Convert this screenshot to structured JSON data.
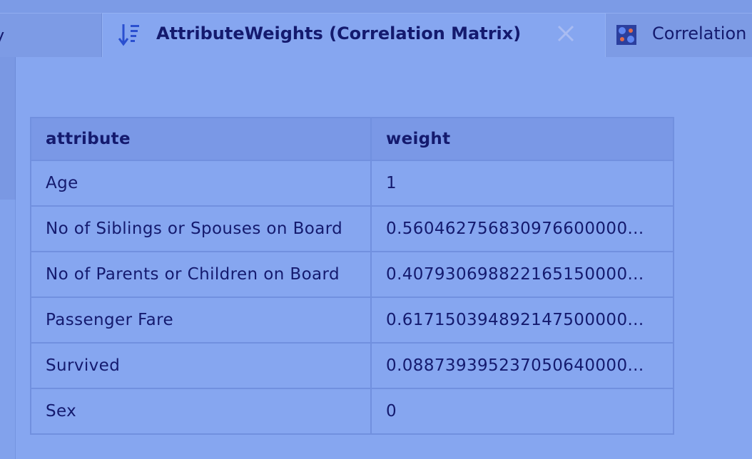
{
  "tabs": {
    "left": {
      "label": "y"
    },
    "active": {
      "label": "AttributeWeights (Correlation Matrix)",
      "icon": "sort-descending-icon"
    },
    "right": {
      "label": "Correlation",
      "icon": "correlation-matrix-icon"
    }
  },
  "table": {
    "headers": [
      "attribute",
      "weight"
    ],
    "rows": [
      [
        "Age",
        "1"
      ],
      [
        "No of Siblings or Spouses on Board",
        "0.560462756830976600000..."
      ],
      [
        "No of Parents or Children on Board",
        "0.407930698822165150000..."
      ],
      [
        "Passenger Fare",
        "0.617150394892147500000..."
      ],
      [
        "Survived",
        "0.088739395237050640000..."
      ],
      [
        "Sex",
        "0"
      ]
    ]
  },
  "colors": {
    "background": "#86a6f0",
    "text": "#141a6e",
    "header_bg": "#7a98e6",
    "border": "#7190df"
  }
}
